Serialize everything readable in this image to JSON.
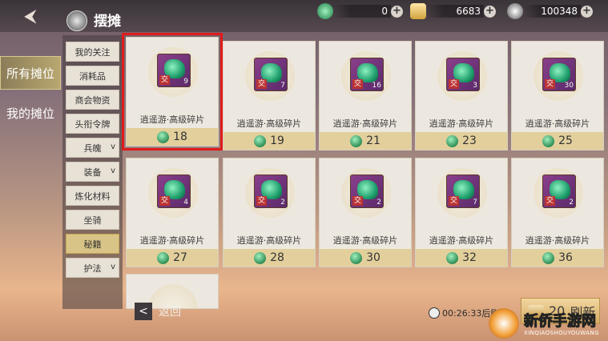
{
  "header": {
    "title": "摆摊"
  },
  "currencies": [
    {
      "icon": "jade-currency-icon",
      "value": "0"
    },
    {
      "icon": "gold-ingot-icon",
      "value": "6683"
    },
    {
      "icon": "silver-coin-icon",
      "value": "100348"
    }
  ],
  "left_tabs": [
    {
      "label": "所有摊位",
      "active": true
    },
    {
      "label": "我的摊位",
      "active": false
    }
  ],
  "categories": [
    {
      "label": "我的关注"
    },
    {
      "label": "消耗品"
    },
    {
      "label": "商会物资"
    },
    {
      "label": "头衔令牌"
    },
    {
      "label": "兵魄",
      "chevron": "v"
    },
    {
      "label": "装备",
      "chevron": "v"
    },
    {
      "label": "炼化材料"
    },
    {
      "label": "坐骑"
    },
    {
      "label": "秘籍",
      "selected": true
    },
    {
      "label": "护法",
      "chevron": "v"
    }
  ],
  "items": [
    {
      "name": "逍遥游·高级碎片",
      "count": "9",
      "price": "18",
      "tag": "交"
    },
    {
      "name": "逍遥游·高级碎片",
      "count": "7",
      "price": "19",
      "tag": "交"
    },
    {
      "name": "逍遥游·高级碎片",
      "count": "16",
      "price": "21",
      "tag": "交"
    },
    {
      "name": "逍遥游·高级碎片",
      "count": "3",
      "price": "23",
      "tag": "交"
    },
    {
      "name": "逍遥游·高级碎片",
      "count": "30",
      "price": "25",
      "tag": "交"
    },
    {
      "name": "逍遥游·高级碎片",
      "count": "4",
      "price": "27",
      "tag": "交"
    },
    {
      "name": "逍遥游·高级碎片",
      "count": "2",
      "price": "28",
      "tag": "交"
    },
    {
      "name": "逍遥游·高级碎片",
      "count": "2",
      "price": "30",
      "tag": "交"
    },
    {
      "name": "逍遥游·高级碎片",
      "count": "7",
      "price": "32",
      "tag": "交"
    },
    {
      "name": "逍遥游·高级碎片",
      "count": "2",
      "price": "36",
      "tag": "交"
    }
  ],
  "footer": {
    "back_label": "返回",
    "back_icon": "<",
    "timer": "00:26:33",
    "timer_suffix": "后刷新",
    "refresh_cost": "20",
    "refresh_label": "刷新"
  },
  "watermark": {
    "brand": "新侨手游网",
    "sub": "XINQIAOSHOUYOUWANG"
  }
}
